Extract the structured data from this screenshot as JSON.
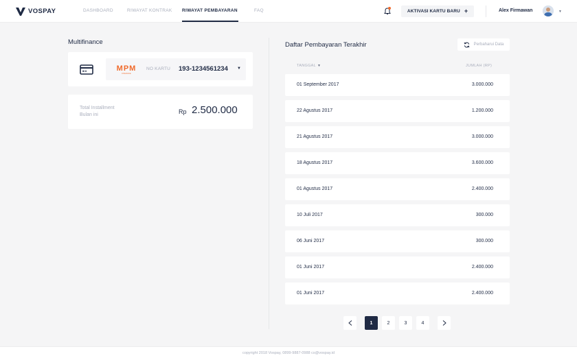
{
  "app": {
    "brand": "VOSPAY"
  },
  "nav": {
    "items": [
      {
        "label": "DASHBOARD",
        "active": false
      },
      {
        "label": "RIWAYAT KONTRAK",
        "active": false
      },
      {
        "label": "RIWAYAT PEMBAYARAN",
        "active": true
      },
      {
        "label": "FAQ",
        "active": false
      }
    ]
  },
  "header": {
    "activate_label": "AKTIVASI KARTU BARU",
    "activate_plus": "+",
    "user_name": "Alex Firmawan",
    "icons": {
      "notifications": "bell-icon",
      "user_menu": "chevron-down-icon"
    }
  },
  "multifinance": {
    "title": "Multifinance",
    "provider_logo_text": "MPM",
    "provider_logo_sub": "FINANCE",
    "card_label": "NO KARTU",
    "card_number": "193-1234561234",
    "installment_label_line1": "Total Installment",
    "installment_label_line2": "Bulan ini",
    "installment_currency": "Rp",
    "installment_amount": "2.500.000"
  },
  "payments": {
    "title": "Daftar Pembayaran Terakhir",
    "refresh_label": "Perbaharui Data",
    "col_date": "TANGGAL",
    "col_amount": "JUMLAH (RP)",
    "rows": [
      {
        "date": "01 September 2017",
        "amount": "3.000.000"
      },
      {
        "date": "22 Agustus  2017",
        "amount": "1.200.000"
      },
      {
        "date": "21 Agustus  2017",
        "amount": "3.000.000"
      },
      {
        "date": "18 Agustus  2017",
        "amount": "3.600.000"
      },
      {
        "date": "01 Agustus  2017",
        "amount": "2.400.000"
      },
      {
        "date": "10 Juli 2017",
        "amount": "300.000"
      },
      {
        "date": "06 Juni 2017",
        "amount": "300.000"
      },
      {
        "date": "01 Juni 2017",
        "amount": "2.400.000"
      },
      {
        "date": "01 Juni 2017",
        "amount": "2.400.000"
      }
    ]
  },
  "pagination": {
    "pages": [
      "1",
      "2",
      "3",
      "4"
    ],
    "current": "1"
  },
  "footer": {
    "text": "copyright 2018 Vospay, 0899-9887-0988 cs@vospay.id"
  },
  "colors": {
    "primary": "#1f2a44",
    "accent": "#f06a2b",
    "background": "#f5f5f6",
    "muted_text": "#a9aebc"
  }
}
